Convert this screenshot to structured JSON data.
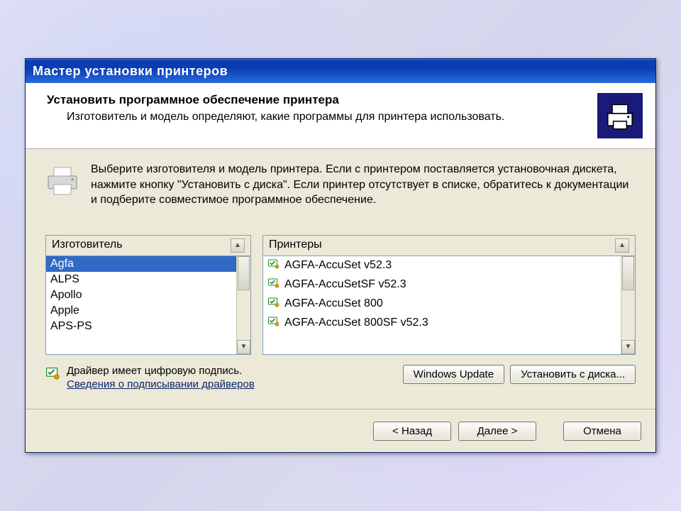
{
  "window": {
    "title": "Мастер установки принтеров"
  },
  "header": {
    "title": "Установить программное обеспечение принтера",
    "subtitle": "Изготовитель и модель определяют, какие программы для принтера использовать."
  },
  "instruction": "Выберите изготовителя и модель принтера. Если с принтером поставляется установочная дискета, нажмите кнопку \"Установить с диска\". Если принтер отсутствует в списке, обратитесь к документации и подберите совместимое программное обеспечение.",
  "lists": {
    "manufacturer": {
      "header": "Изготовитель",
      "items": [
        "Agfa",
        "ALPS",
        "Apollo",
        "Apple",
        "APS-PS"
      ],
      "selected_index": 0
    },
    "printers": {
      "header": "Принтеры",
      "items": [
        "AGFA-AccuSet v52.3",
        "AGFA-AccuSetSF v52.3",
        "AGFA-AccuSet 800",
        "AGFA-AccuSet 800SF v52.3"
      ]
    }
  },
  "signature": {
    "status": "Драйвер имеет цифровую подпись.",
    "link": "Сведения о подписывании драйверов"
  },
  "buttons": {
    "windows_update": "Windows Update",
    "install_from_disk": "Установить с диска...",
    "back": "< Назад",
    "next": "Далее >",
    "cancel": "Отмена"
  }
}
